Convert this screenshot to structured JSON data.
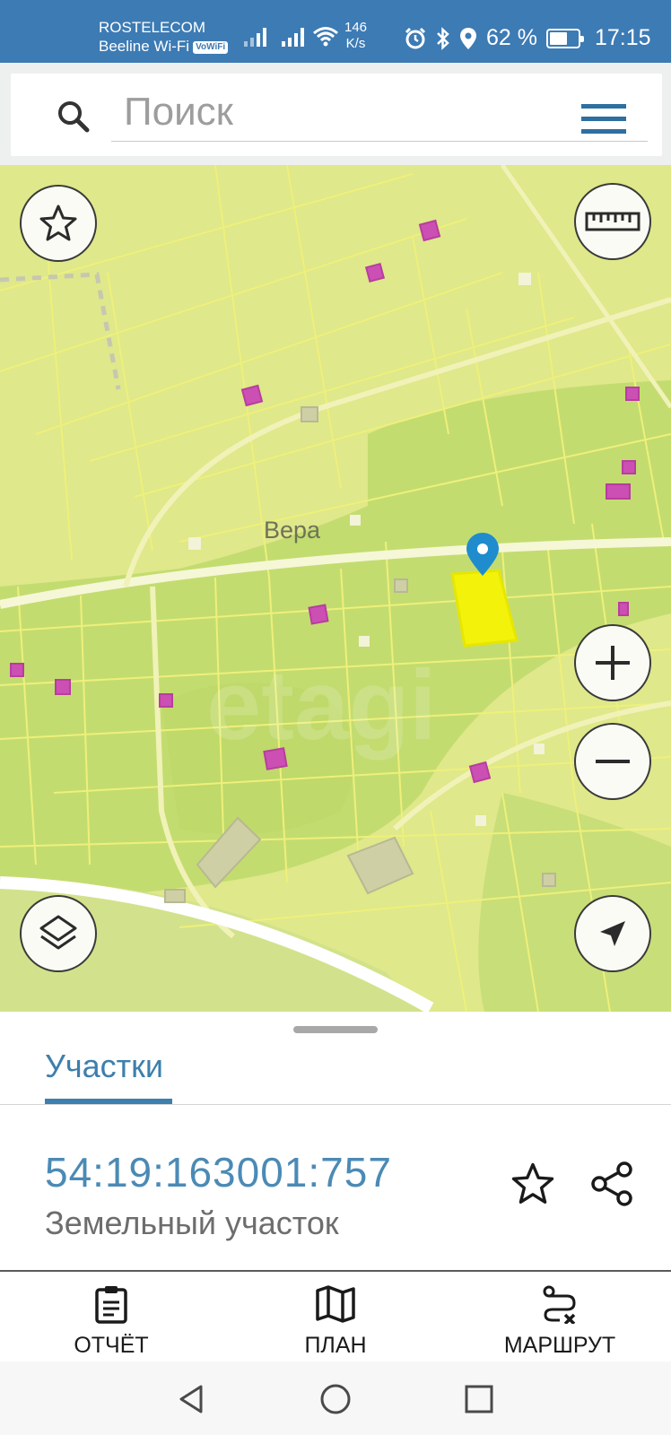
{
  "status_bar": {
    "carrier_1": "ROSTELECOM",
    "carrier_2": "Beeline Wi-Fi",
    "vowifi_badge": "VoWiFi",
    "speed_value": "146",
    "speed_unit": "K/s",
    "battery_percent": "62 %",
    "battery_level": 0.62,
    "time": "17:15",
    "icons": [
      "signal-icon",
      "signal-icon",
      "wifi-icon",
      "alarm-icon",
      "bluetooth-icon",
      "location-icon",
      "battery-icon"
    ]
  },
  "search": {
    "placeholder": "Поиск",
    "value": ""
  },
  "map": {
    "place_label": "Вера",
    "watermark": "etagi",
    "controls": [
      "favorites-star-icon",
      "ruler-icon",
      "zoom-in-icon",
      "zoom-out-icon",
      "layers-icon",
      "my-location-icon"
    ]
  },
  "sheet": {
    "tab_label": "Участки",
    "parcel_id": "54:19:163001:757",
    "parcel_type": "Земельный участок"
  },
  "actions": {
    "report_label": "ОТЧЁТ",
    "plan_label": "ПЛАН",
    "route_label": "МАРШРУТ"
  },
  "colors": {
    "status_bar": "#3d7bb4",
    "accent": "#3d7fad",
    "map_base": "#dfe88a",
    "forest": "#c3dc70",
    "parcel_highlight": "#f2f20a",
    "building": "#cc4fb3"
  }
}
